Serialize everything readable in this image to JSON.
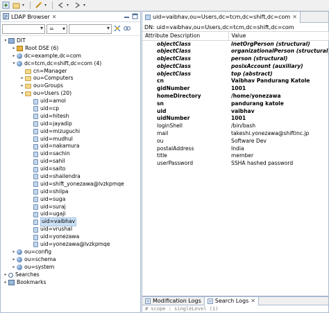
{
  "toolbar": {
    "icons": [
      "new-entry-icon",
      "open-icon",
      "connection-icon",
      "back-icon",
      "forward-icon"
    ]
  },
  "left_panel": {
    "title": "LDAP Browser",
    "filter_combo": "",
    "operator_combo": "=",
    "value_combo": ""
  },
  "tree": [
    {
      "label": "DIT",
      "level": 0,
      "toggle": "▾",
      "icon": "dit"
    },
    {
      "label": "Root DSE (6)",
      "level": 1,
      "toggle": "▸",
      "icon": "root"
    },
    {
      "label": "dc=example,dc=com",
      "level": 1,
      "toggle": "▸",
      "icon": "globe"
    },
    {
      "label": "dc=tcm,dc=shift,dc=com (4)",
      "level": 1,
      "toggle": "▾",
      "icon": "globe"
    },
    {
      "label": "cn=Manager",
      "level": 2,
      "toggle": "",
      "icon": "folder"
    },
    {
      "label": "ou=Computers",
      "level": 2,
      "toggle": "▸",
      "icon": "folder"
    },
    {
      "label": "ou=Groups",
      "level": 2,
      "toggle": "▸",
      "icon": "folder"
    },
    {
      "label": "ou=Users (20)",
      "level": 2,
      "toggle": "▾",
      "icon": "folder"
    },
    {
      "label": "uid=amol",
      "level": 3,
      "toggle": "",
      "icon": "entry"
    },
    {
      "label": "uid=cp",
      "level": 3,
      "toggle": "",
      "icon": "entry"
    },
    {
      "label": "uid=hitesh",
      "level": 3,
      "toggle": "",
      "icon": "entry"
    },
    {
      "label": "uid=jayadip",
      "level": 3,
      "toggle": "",
      "icon": "entry"
    },
    {
      "label": "uid=mizuguchi",
      "level": 3,
      "toggle": "",
      "icon": "entry"
    },
    {
      "label": "uid=mudhul",
      "level": 3,
      "toggle": "",
      "icon": "entry"
    },
    {
      "label": "uid=nakamura",
      "level": 3,
      "toggle": "",
      "icon": "entry"
    },
    {
      "label": "uid=sachin",
      "level": 3,
      "toggle": "",
      "icon": "entry"
    },
    {
      "label": "uid=sahil",
      "level": 3,
      "toggle": "",
      "icon": "entry"
    },
    {
      "label": "uid=saito",
      "level": 3,
      "toggle": "",
      "icon": "entry"
    },
    {
      "label": "uid=shailendra",
      "level": 3,
      "toggle": "",
      "icon": "entry"
    },
    {
      "label": "uid=shift_yonezawa@lvzkpmqe",
      "level": 3,
      "toggle": "",
      "icon": "entry"
    },
    {
      "label": "uid=shilpa",
      "level": 3,
      "toggle": "",
      "icon": "entry"
    },
    {
      "label": "uid=suga",
      "level": 3,
      "toggle": "",
      "icon": "entry"
    },
    {
      "label": "uid=suraj",
      "level": 3,
      "toggle": "",
      "icon": "entry"
    },
    {
      "label": "uid=ugaji",
      "level": 3,
      "toggle": "",
      "icon": "entry"
    },
    {
      "label": "uid=vaibhav",
      "level": 3,
      "toggle": "",
      "icon": "entry",
      "selected": true
    },
    {
      "label": "uid=vrushal",
      "level": 3,
      "toggle": "",
      "icon": "entry"
    },
    {
      "label": "uid=yonezawa",
      "level": 3,
      "toggle": "",
      "icon": "entry"
    },
    {
      "label": "uid=yonezawa@lvzkpmqe",
      "level": 3,
      "toggle": "",
      "icon": "entry"
    },
    {
      "label": "ou=config",
      "level": 1,
      "toggle": "▸",
      "icon": "globe"
    },
    {
      "label": "ou=schema",
      "level": 1,
      "toggle": "▸",
      "icon": "globe"
    },
    {
      "label": "ou=system",
      "level": 1,
      "toggle": "▸",
      "icon": "globe"
    },
    {
      "label": "Searches",
      "level": 0,
      "toggle": "▸",
      "icon": "search"
    },
    {
      "label": "Bookmarks",
      "level": 0,
      "toggle": "▸",
      "icon": "book"
    }
  ],
  "editor": {
    "tab_title": "uid=vaibhav,ou=Users,dc=tcm,dc=shift,dc=com",
    "dn_line": "DN: uid=vaibhav,ou=Users,dc=tcm,dc=shift,dc=com",
    "columns": [
      "Attribute Description",
      "Value"
    ],
    "rows": [
      {
        "attr": "objectClass",
        "value": "inetOrgPerson (structural)",
        "style": "bold-italic"
      },
      {
        "attr": "objectClass",
        "value": "organizationalPerson (structural)",
        "style": "bold-italic"
      },
      {
        "attr": "objectClass",
        "value": "person (structural)",
        "style": "bold-italic"
      },
      {
        "attr": "objectClass",
        "value": "posixAccount (auxiliary)",
        "style": "bold-italic"
      },
      {
        "attr": "objectClass",
        "value": "top (abstract)",
        "style": "bold-italic"
      },
      {
        "attr": "cn",
        "value": "Vaibhav Pandurang Katole",
        "style": "bold"
      },
      {
        "attr": "gidNumber",
        "value": "1001",
        "style": "bold"
      },
      {
        "attr": "homeDirectory",
        "value": "/home/yonezawa",
        "style": "bold"
      },
      {
        "attr": "sn",
        "value": "pandurang katole",
        "style": "bold"
      },
      {
        "attr": "uid",
        "value": "vaibhav",
        "style": "bold"
      },
      {
        "attr": "uidNumber",
        "value": "1001",
        "style": "bold"
      },
      {
        "attr": "loginShell",
        "value": "/bin/bash",
        "style": "normal"
      },
      {
        "attr": "mail",
        "value": "takeshi.yonezawa@shiftinc.jp",
        "style": "normal"
      },
      {
        "attr": "ou",
        "value": "Software Dev",
        "style": "normal"
      },
      {
        "attr": "postalAddress",
        "value": "India",
        "style": "normal"
      },
      {
        "attr": "title",
        "value": "member",
        "style": "normal"
      },
      {
        "attr": "userPassword",
        "value": "SSHA hashed password",
        "style": "normal"
      }
    ]
  },
  "bottom": {
    "tabs": [
      {
        "label": "Modification Logs",
        "active": false
      },
      {
        "label": "Search Logs",
        "active": true
      }
    ],
    "log_text": "# scope   : singleLevel (1)"
  }
}
